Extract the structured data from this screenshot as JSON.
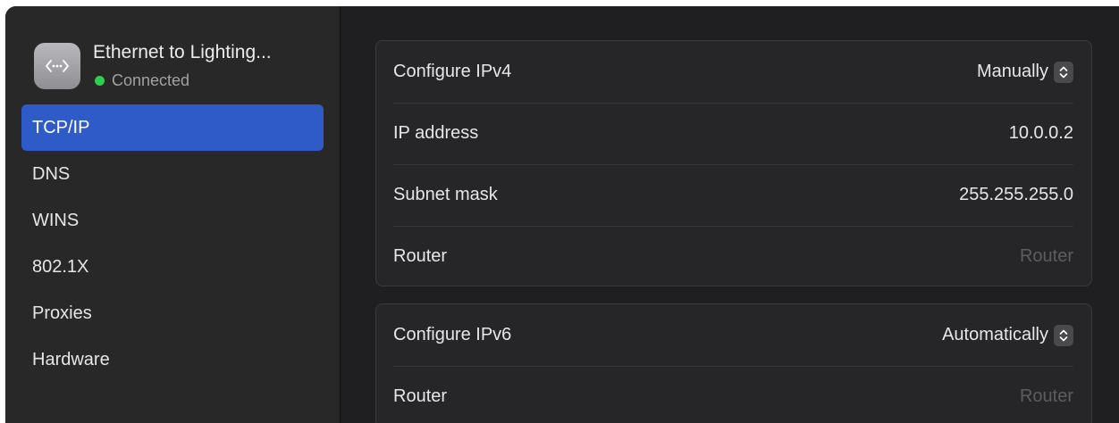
{
  "device": {
    "name": "Ethernet to Lighting...",
    "status": "Connected",
    "icon": "ethernet-icon"
  },
  "sidebar": {
    "items": [
      {
        "label": "TCP/IP",
        "active": true
      },
      {
        "label": "DNS"
      },
      {
        "label": "WINS"
      },
      {
        "label": "802.1X"
      },
      {
        "label": "Proxies"
      },
      {
        "label": "Hardware"
      }
    ]
  },
  "ipv4": {
    "configure_label": "Configure IPv4",
    "configure_value": "Manually",
    "ip_label": "IP address",
    "ip_value": "10.0.0.2",
    "subnet_label": "Subnet mask",
    "subnet_value": "255.255.255.0",
    "router_label": "Router",
    "router_placeholder": "Router"
  },
  "ipv6": {
    "configure_label": "Configure IPv6",
    "configure_value": "Automatically",
    "router_label": "Router",
    "router_value": "Router"
  },
  "colors": {
    "accent": "#2e5bc8",
    "status_green": "#2fcc51"
  }
}
